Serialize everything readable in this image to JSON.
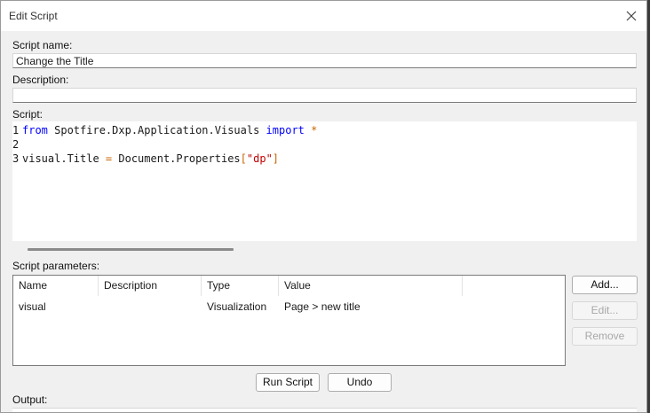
{
  "window": {
    "title": "Edit Script"
  },
  "script_name": {
    "label": "Script name:",
    "value": "Change the Title"
  },
  "description": {
    "label": "Description:",
    "value": ""
  },
  "script": {
    "label": "Script:",
    "line_numbers": [
      "1",
      "2",
      "3"
    ],
    "line1": {
      "from": "from",
      "module": " Spotfire.Dxp.Application.Visuals ",
      "import": "import",
      "sp": " ",
      "star": "*"
    },
    "line3": {
      "lhs": "visual.Title ",
      "eq": "=",
      "mid": " Document.Properties",
      "ob": "[",
      "str": "\"dp\"",
      "cb": "]"
    }
  },
  "parameters": {
    "label": "Script parameters:",
    "columns": [
      "Name",
      "Description",
      "Type",
      "Value"
    ],
    "rows": [
      {
        "name": "visual",
        "description": "",
        "type": "Visualization",
        "value": "Page > new title"
      }
    ],
    "add_label": "Add...",
    "edit_label": "Edit...",
    "remove_label": "Remove"
  },
  "actions": {
    "run_label": "Run Script",
    "undo_label": "Undo"
  },
  "output": {
    "label": "Output:"
  }
}
